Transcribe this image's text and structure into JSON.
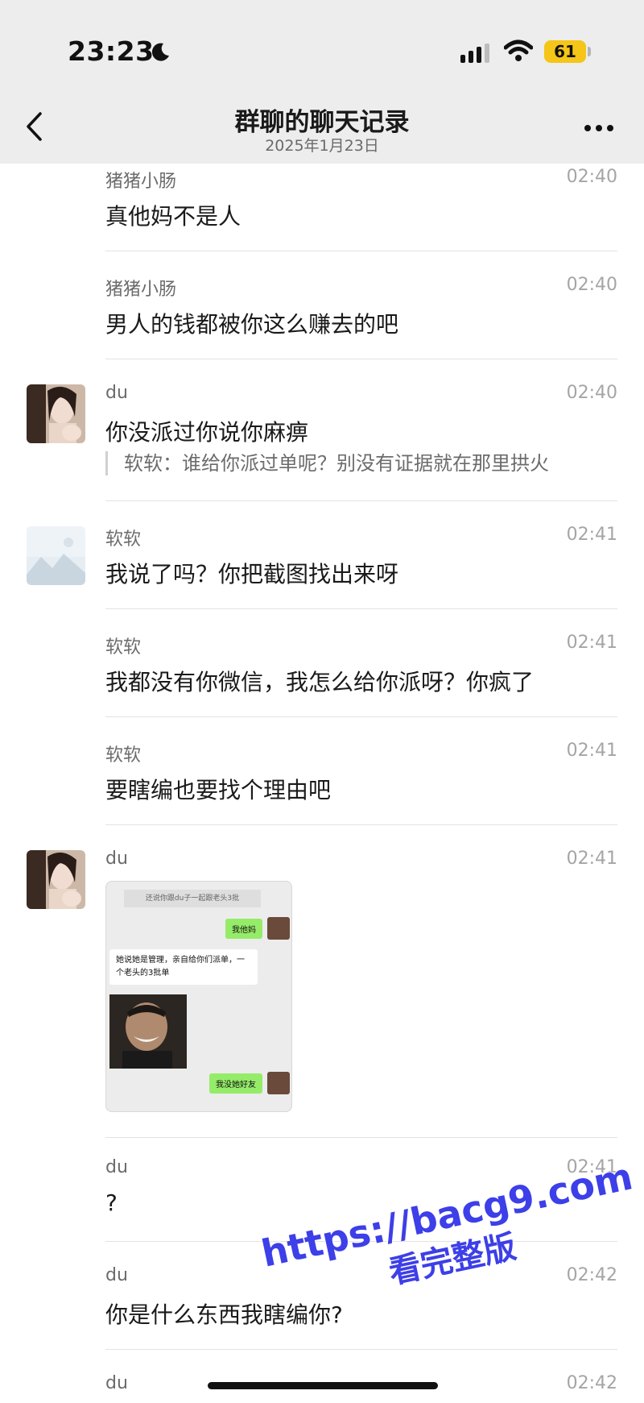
{
  "status_bar": {
    "time": "23:23",
    "battery": "61"
  },
  "header": {
    "title": "群聊的聊天记录",
    "subtitle": "2025年1月23日"
  },
  "messages": [
    {
      "sender": "猪猪小肠",
      "time": "02:40",
      "text": "真他妈不是人"
    },
    {
      "sender": "猪猪小肠",
      "time": "02:40",
      "text": "男人的钱都被你这么赚去的吧"
    },
    {
      "sender": "du",
      "time": "02:40",
      "text": "你没派过你说你麻痹",
      "quote": "软软：谁给你派过单呢？别没有证据就在那里拱火"
    },
    {
      "sender": "软软",
      "time": "02:41",
      "text": "我说了吗？你把截图找出来呀"
    },
    {
      "sender": "软软",
      "time": "02:41",
      "text": "我都没有你微信，我怎么给你派呀？你疯了"
    },
    {
      "sender": "软软",
      "time": "02:41",
      "text": "要瞎编也要找个理由吧"
    },
    {
      "sender": "du",
      "time": "02:41"
    },
    {
      "sender": "du",
      "time": "02:41",
      "text": "?"
    },
    {
      "sender": "du",
      "time": "02:42",
      "text": "你是什么东西我瞎编你?"
    },
    {
      "sender": "du",
      "time": "02:42"
    }
  ],
  "screenshot": {
    "system_text": "还说你跟du子一起跟老头3批",
    "green_1": "我他妈",
    "white_1": "她说她是管理，亲自给你们派单，一个老头的3批单",
    "green_2": "我没她好友"
  },
  "watermark": {
    "url": "https://bacg9.com",
    "sub": "看完整版"
  },
  "icons": [
    "moon-icon",
    "signal-icon",
    "wifi-icon",
    "battery-icon",
    "back-icon",
    "more-icon"
  ]
}
